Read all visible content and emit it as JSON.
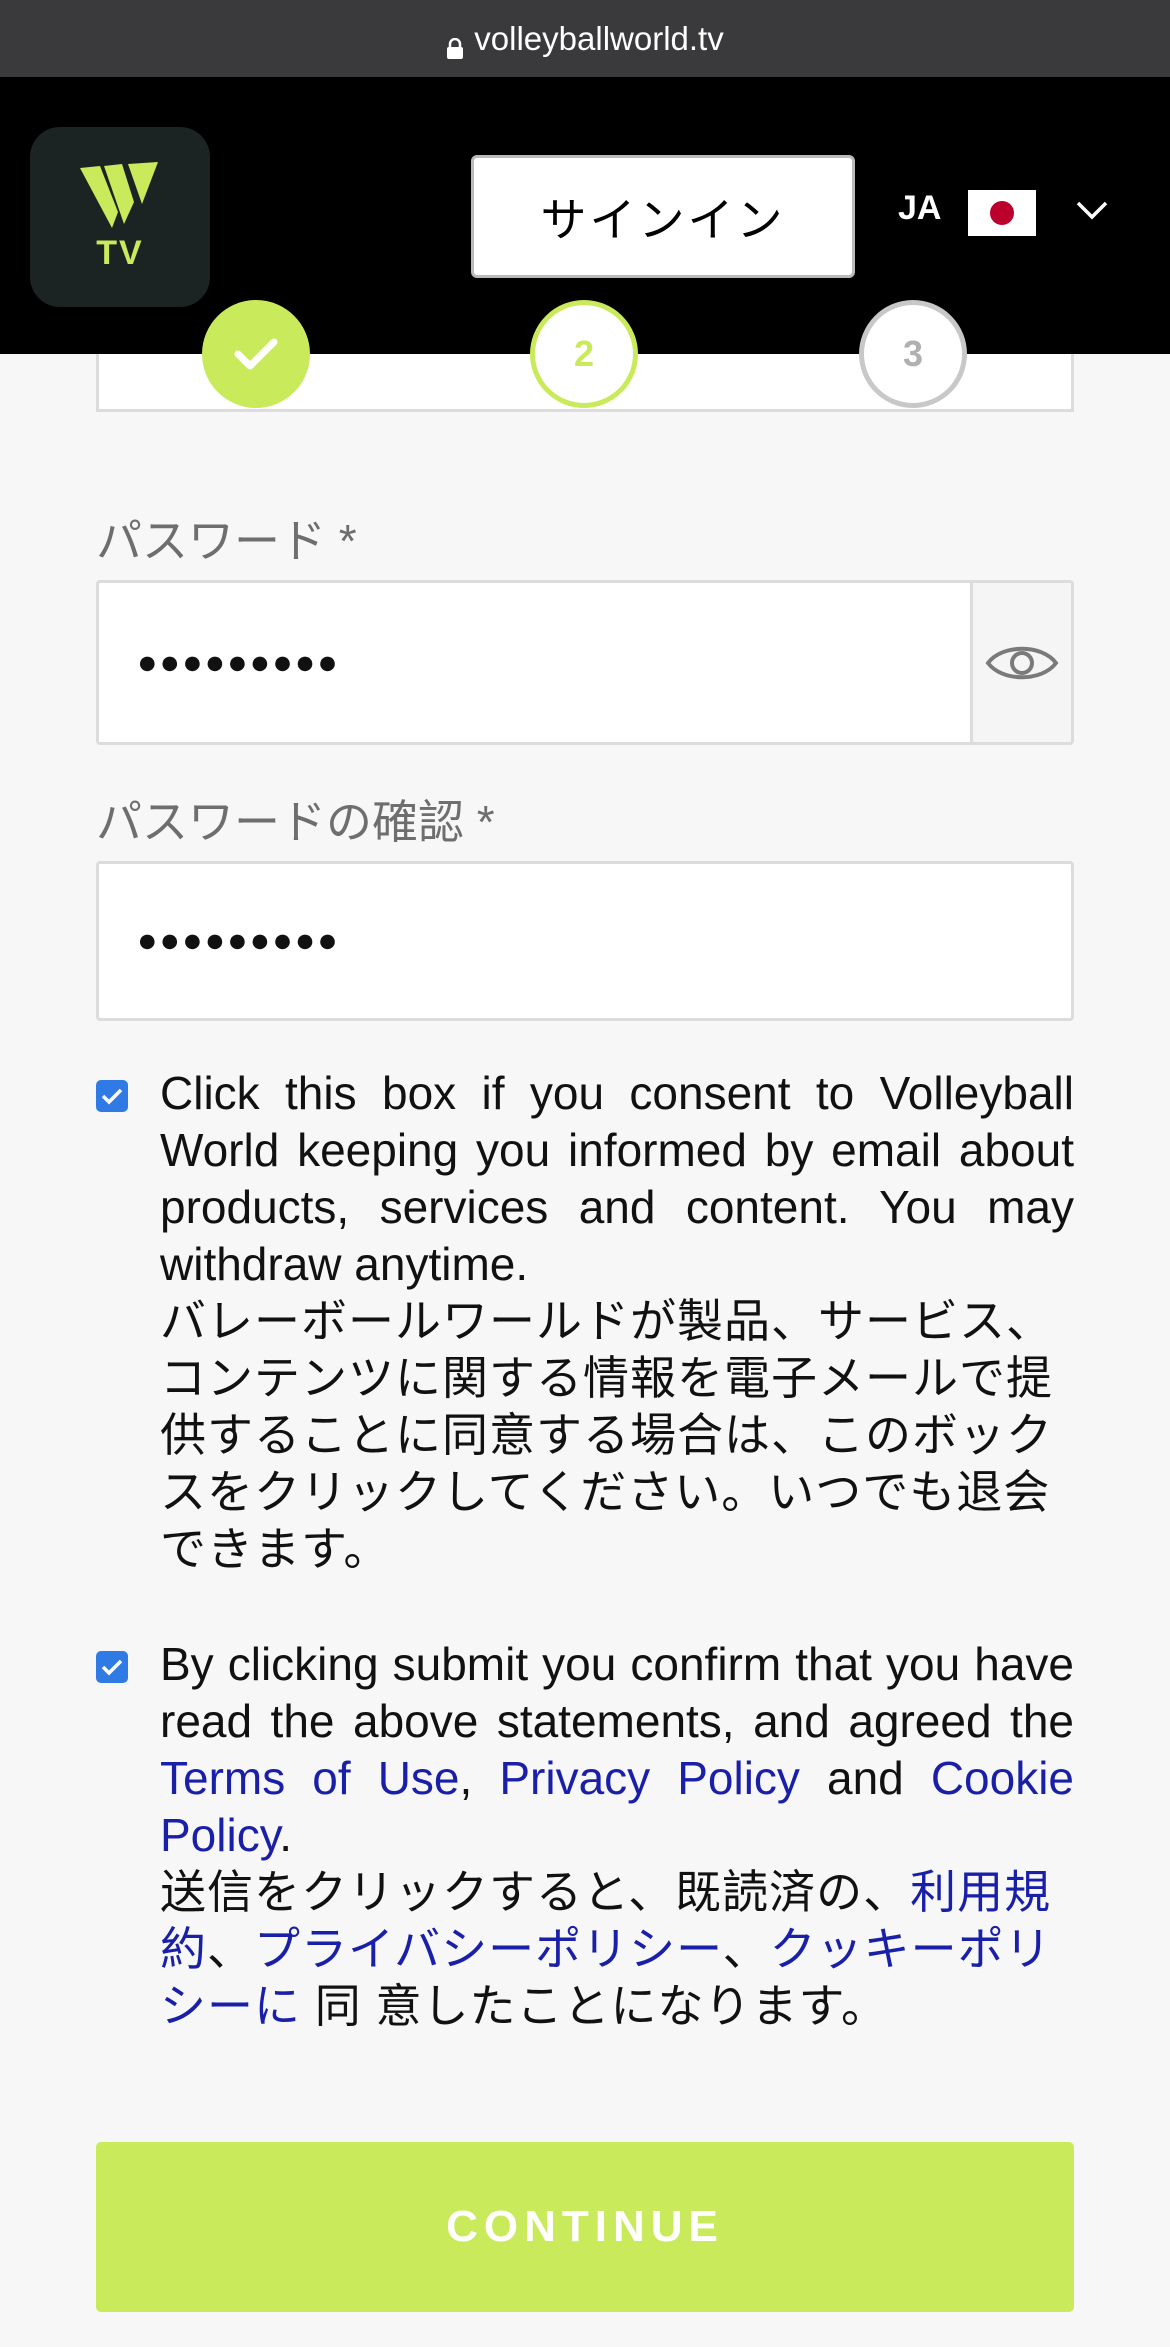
{
  "browser": {
    "url": "volleyballworld.tv"
  },
  "header": {
    "logo_text": "TV",
    "signin_label": "サインイン",
    "language": "JA"
  },
  "stepper": {
    "steps": [
      {
        "label": "",
        "state": "completed"
      },
      {
        "label": "2",
        "state": "current"
      },
      {
        "label": "3",
        "state": "upcoming"
      }
    ]
  },
  "form": {
    "password_label": "パスワード *",
    "password_value": "●●●●●●●●●",
    "confirm_label": "パスワードの確認 *",
    "confirm_value": "●●●●●●●●●",
    "consent_marketing": {
      "checked": true,
      "text_en": "Click this box if you consent to Volleyball World keeping you informed by email about products, services and content. You may withdraw anytime.",
      "text_ja": "バレーボールワールドが製品、サービス、コンテンツに関する情報を電子メールで提供することに同意する場合は、このボックスをクリックしてください。いつでも退会できます。"
    },
    "consent_terms": {
      "checked": true,
      "text_en_1": "By clicking submit you confirm that you have read the above statements, and agreed the ",
      "terms_link": "Terms of Use",
      "sep_1": ", ",
      "privacy_link": "Privacy Policy",
      "sep_2": " and ",
      "cookie_link": "Cookie Policy",
      "end": ".",
      "text_ja_1": "送信をクリックすると、既読済の、",
      "terms_link_ja": "利用規約",
      "sep_ja_1": "、",
      "privacy_link_ja": "プライバシーポリシー",
      "sep_ja_2": "、",
      "cookie_link_ja": "クッキーポリシーに",
      "text_ja_2": " 同 意したことになります。"
    },
    "continue_label": "CONTINUE"
  },
  "colors": {
    "accent": "#c9ea5b",
    "link": "#1a1fa8",
    "checkbox": "#2f7ae5"
  }
}
